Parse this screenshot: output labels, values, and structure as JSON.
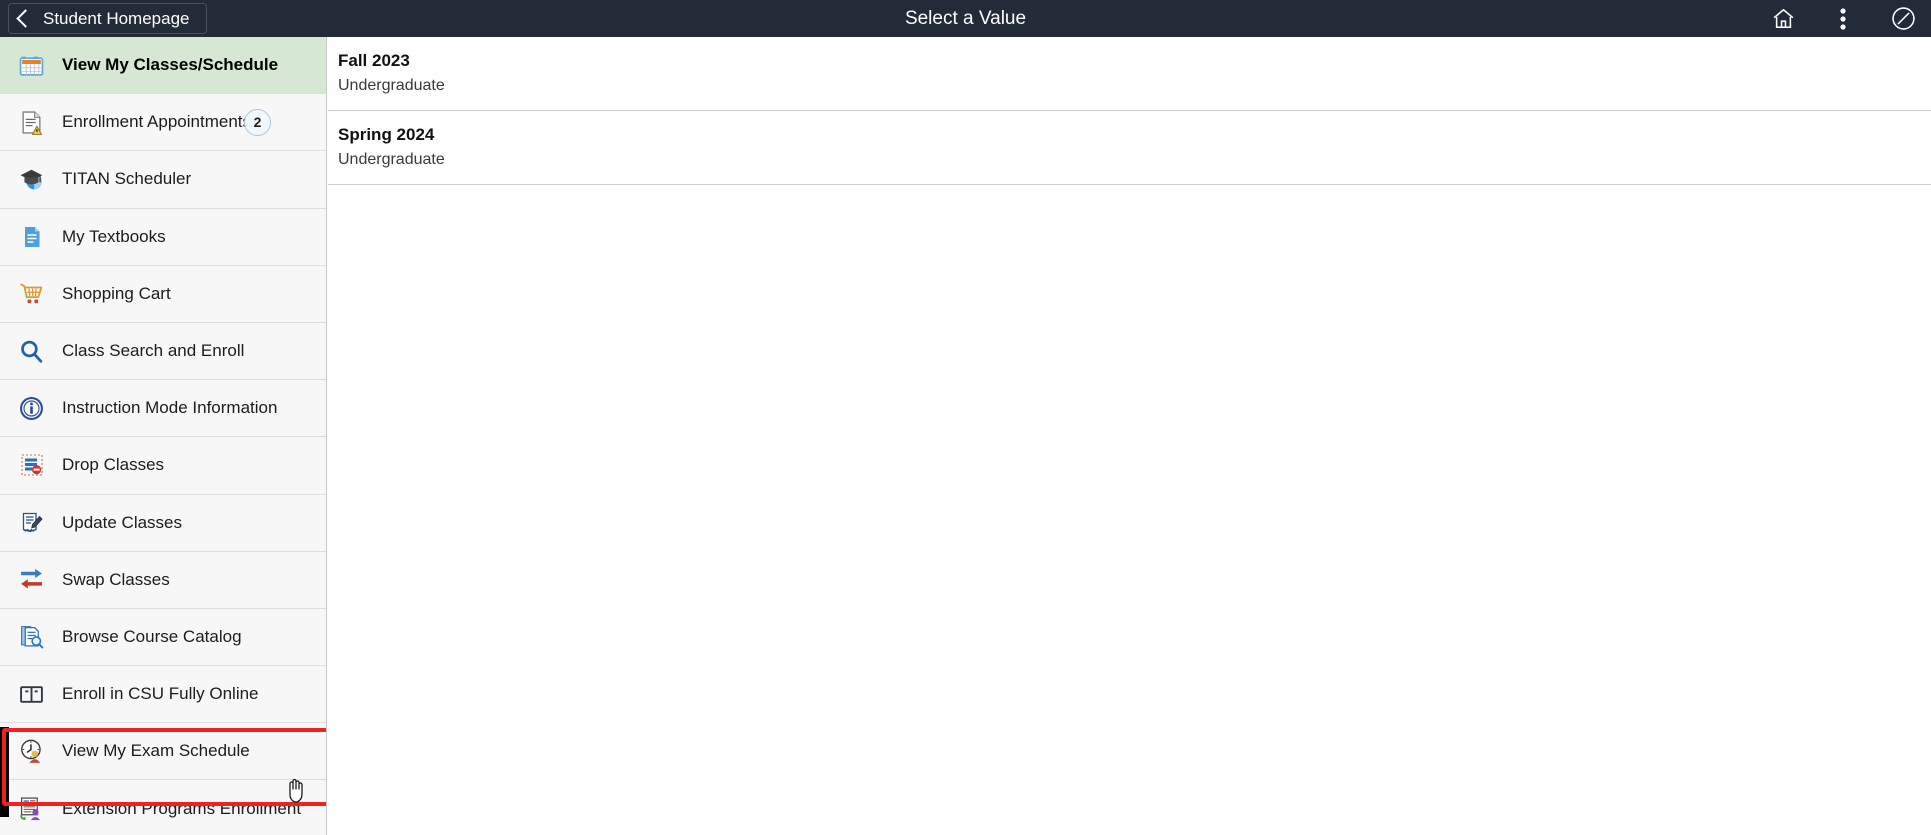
{
  "header": {
    "back_label": "Student Homepage",
    "title": "Select a Value",
    "icons": [
      {
        "name": "home-icon",
        "glyph": "home"
      },
      {
        "name": "actions-menu-icon",
        "glyph": "kebab"
      },
      {
        "name": "nav-bar-icon",
        "glyph": "circle-slash"
      }
    ]
  },
  "sidebar": {
    "items": [
      {
        "label": "View My Classes/Schedule",
        "icon": "calendar-icon",
        "selected": true,
        "badge": null
      },
      {
        "label": "Enrollment Appointments",
        "icon": "document-warning-icon",
        "selected": false,
        "badge": "2"
      },
      {
        "label": "TITAN Scheduler",
        "icon": "graduation-cap-icon",
        "selected": false,
        "badge": null
      },
      {
        "label": "My Textbooks",
        "icon": "book-page-icon",
        "selected": false,
        "badge": null
      },
      {
        "label": "Shopping Cart",
        "icon": "shopping-cart-icon",
        "selected": false,
        "badge": null
      },
      {
        "label": "Class Search and Enroll",
        "icon": "search-icon",
        "selected": false,
        "badge": null
      },
      {
        "label": "Instruction Mode Information",
        "icon": "info-icon",
        "selected": false,
        "badge": null
      },
      {
        "label": "Drop Classes",
        "icon": "drop-classes-icon",
        "selected": false,
        "badge": null
      },
      {
        "label": "Update Classes",
        "icon": "edit-document-icon",
        "selected": false,
        "badge": null
      },
      {
        "label": "Swap Classes",
        "icon": "swap-arrows-icon",
        "selected": false,
        "badge": null
      },
      {
        "label": "Browse Course Catalog",
        "icon": "catalog-search-icon",
        "selected": false,
        "badge": null
      },
      {
        "label": "Enroll in CSU Fully Online",
        "icon": "open-book-icon",
        "selected": false,
        "badge": null
      },
      {
        "label": "View My Exam Schedule",
        "icon": "clock-person-icon",
        "selected": false,
        "badge": null,
        "highlighted": true
      },
      {
        "label": "Extension Programs Enrollment",
        "icon": "extension-person-icon",
        "selected": false,
        "badge": null
      }
    ]
  },
  "main": {
    "rows": [
      {
        "title": "Fall 2023",
        "subtitle": "Undergraduate"
      },
      {
        "title": "Spring 2024",
        "subtitle": "Undergraduate"
      }
    ]
  },
  "colors": {
    "header_bg": "#232a38",
    "selected_row": "#d6e8d4",
    "highlight_outline": "#ee2222",
    "sidebar_bg": "#f7f7f7"
  }
}
